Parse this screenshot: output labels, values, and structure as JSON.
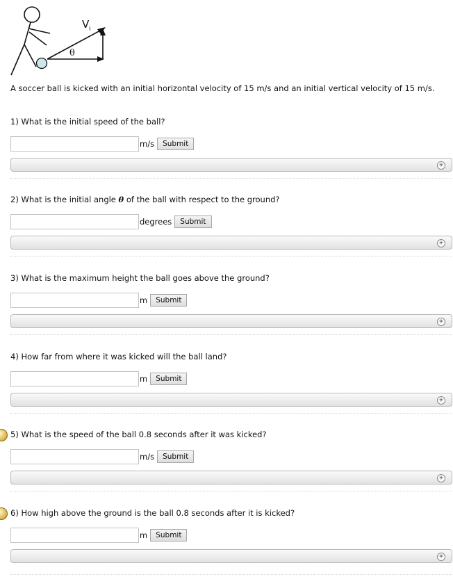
{
  "figure": {
    "velocity_label": "V",
    "velocity_subscript": "i",
    "angle_label": "θ"
  },
  "intro": "A soccer ball is kicked with an initial horizontal velocity of 15 m/s and an initial vertical velocity of 15 m/s.",
  "questions": [
    {
      "label": "1) What is the initial speed of the ball?",
      "unit": "m/s",
      "value": "",
      "submit": "Submit",
      "has_hint": false
    },
    {
      "label_pre": "2) What is the initial angle ",
      "label_symbol": "θ",
      "label_post": " of the ball with respect to the ground?",
      "unit": "degrees",
      "value": "",
      "submit": "Submit",
      "has_hint": false
    },
    {
      "label": "3) What is the maximum height the ball goes above the ground?",
      "unit": "m",
      "value": "",
      "submit": "Submit",
      "has_hint": false
    },
    {
      "label": "4) How far from where it was kicked will the ball land?",
      "unit": "m",
      "value": "",
      "submit": "Submit",
      "has_hint": false
    },
    {
      "label": "5) What is the speed of the ball 0.8 seconds after it was kicked?",
      "unit": "m/s",
      "value": "",
      "submit": "Submit",
      "has_hint": true
    },
    {
      "label": "6) How high above the ground is the ball 0.8 seconds after it is kicked?",
      "unit": "m",
      "value": "",
      "submit": "Submit",
      "has_hint": true
    }
  ],
  "colors": {
    "ball_fill": "#cce6ec",
    "hint_icon": "#d8b445"
  },
  "icons": {
    "expand": "plus-circle-icon",
    "hint": "hint-icon"
  }
}
